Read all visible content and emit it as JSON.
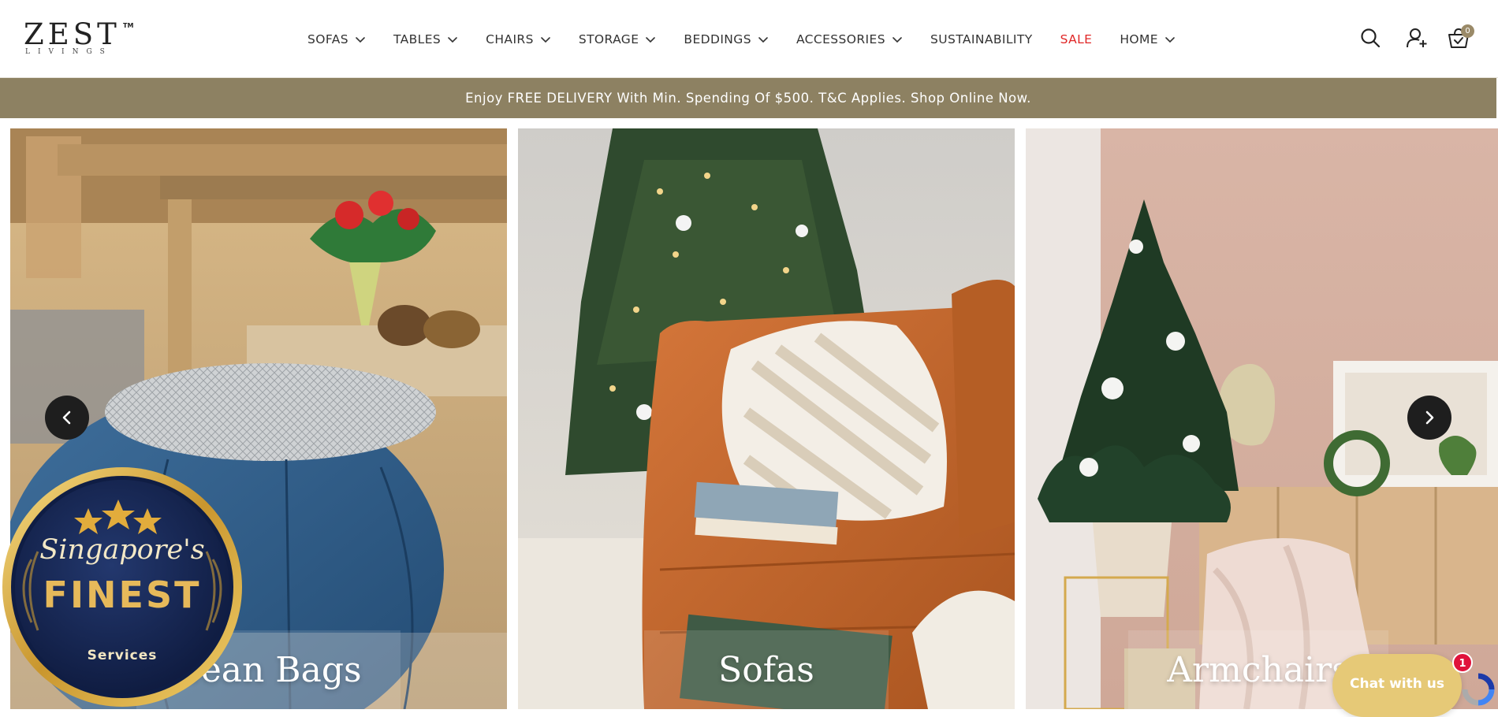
{
  "brand": {
    "logo_main": "ZEST",
    "logo_tm": "TM",
    "logo_sub": "LIVINGS"
  },
  "nav": {
    "items": [
      {
        "label": "SOFAS",
        "has_dropdown": true
      },
      {
        "label": "TABLES",
        "has_dropdown": true
      },
      {
        "label": "CHAIRS",
        "has_dropdown": true
      },
      {
        "label": "STORAGE",
        "has_dropdown": true
      },
      {
        "label": "BEDDINGS",
        "has_dropdown": true
      },
      {
        "label": "ACCESSORIES",
        "has_dropdown": true
      },
      {
        "label": "SUSTAINABILITY",
        "has_dropdown": false
      },
      {
        "label": "SALE",
        "has_dropdown": false,
        "color": "#e02727"
      },
      {
        "label": "HOME",
        "has_dropdown": true
      }
    ]
  },
  "header_icons": {
    "search": "search-icon",
    "account": "user-icon",
    "cart": "cart-icon",
    "cart_count": "0"
  },
  "announcement": {
    "text": "Enjoy FREE DELIVERY With Min. Spending Of $500. T&C Applies. Shop Online Now."
  },
  "carousel": {
    "prev_icon": "chevron-left-icon",
    "next_icon": "chevron-right-icon",
    "cards": [
      {
        "label": "Bean Bags"
      },
      {
        "label": "Sofas"
      },
      {
        "label": "Armchairs"
      }
    ]
  },
  "badge": {
    "script_text": "Singapore's",
    "main_text": "FINEST",
    "sub_text": "Services",
    "stars": 3
  },
  "chat": {
    "label": "Chat with us",
    "unread": "1"
  },
  "colors": {
    "announce_bg": "#8d8162",
    "sale": "#e02727",
    "chat_bg": "#e6c977",
    "badge_gold": "#d4a93a",
    "badge_navy": "#142452"
  }
}
